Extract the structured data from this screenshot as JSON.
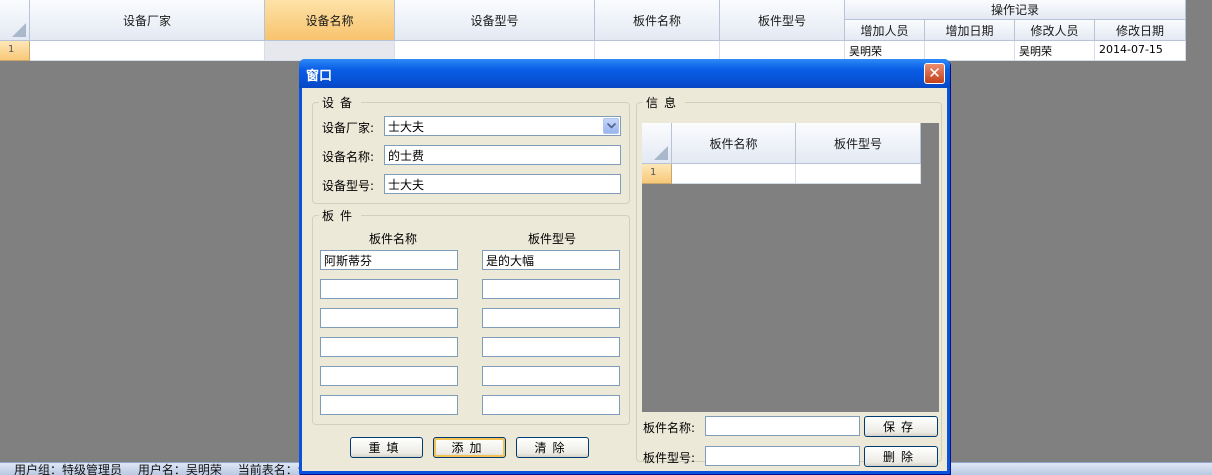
{
  "background_grid": {
    "columns": [
      "设备厂家",
      "设备名称",
      "设备型号",
      "板件名称",
      "板件型号"
    ],
    "group_header": "操作记录",
    "sub_columns": [
      "增加人员",
      "增加日期",
      "修改人员",
      "修改日期"
    ],
    "row_number": "1",
    "row": {
      "add_person": "吴明荣",
      "add_date": "",
      "modify_person": "吴明荣",
      "modify_date": "2014-07-15"
    }
  },
  "status_bar": {
    "user_group": "用户组：特级管理员",
    "user_name": "用户名：吴明荣",
    "current_table": "当前表名：设"
  },
  "dialog": {
    "title": "窗口",
    "close_glyph": "✕",
    "device_group": {
      "legend": "设备",
      "vendor_label": "设备厂家:",
      "vendor_value": "士大夫",
      "name_label": "设备名称:",
      "name_value": "的士费",
      "model_label": "设备型号:",
      "model_value": "士大夫"
    },
    "board_group": {
      "legend": "板件",
      "name_header": "板件名称",
      "model_header": "板件型号",
      "rows": [
        {
          "name": "阿斯蒂芬",
          "model": "是的大幅"
        },
        {
          "name": "",
          "model": ""
        },
        {
          "name": "",
          "model": ""
        },
        {
          "name": "",
          "model": ""
        },
        {
          "name": "",
          "model": ""
        },
        {
          "name": "",
          "model": ""
        }
      ]
    },
    "buttons": {
      "reset": "重填",
      "add": "添加",
      "clear": "清除",
      "save": "保存",
      "delete": "删除"
    },
    "info_group": {
      "legend": "信息",
      "columns": [
        "板件名称",
        "板件型号"
      ],
      "row_number": "1",
      "board_name_label": "板件名称:",
      "board_model_label": "板件型号:",
      "board_name_value": "",
      "board_model_value": ""
    }
  }
}
